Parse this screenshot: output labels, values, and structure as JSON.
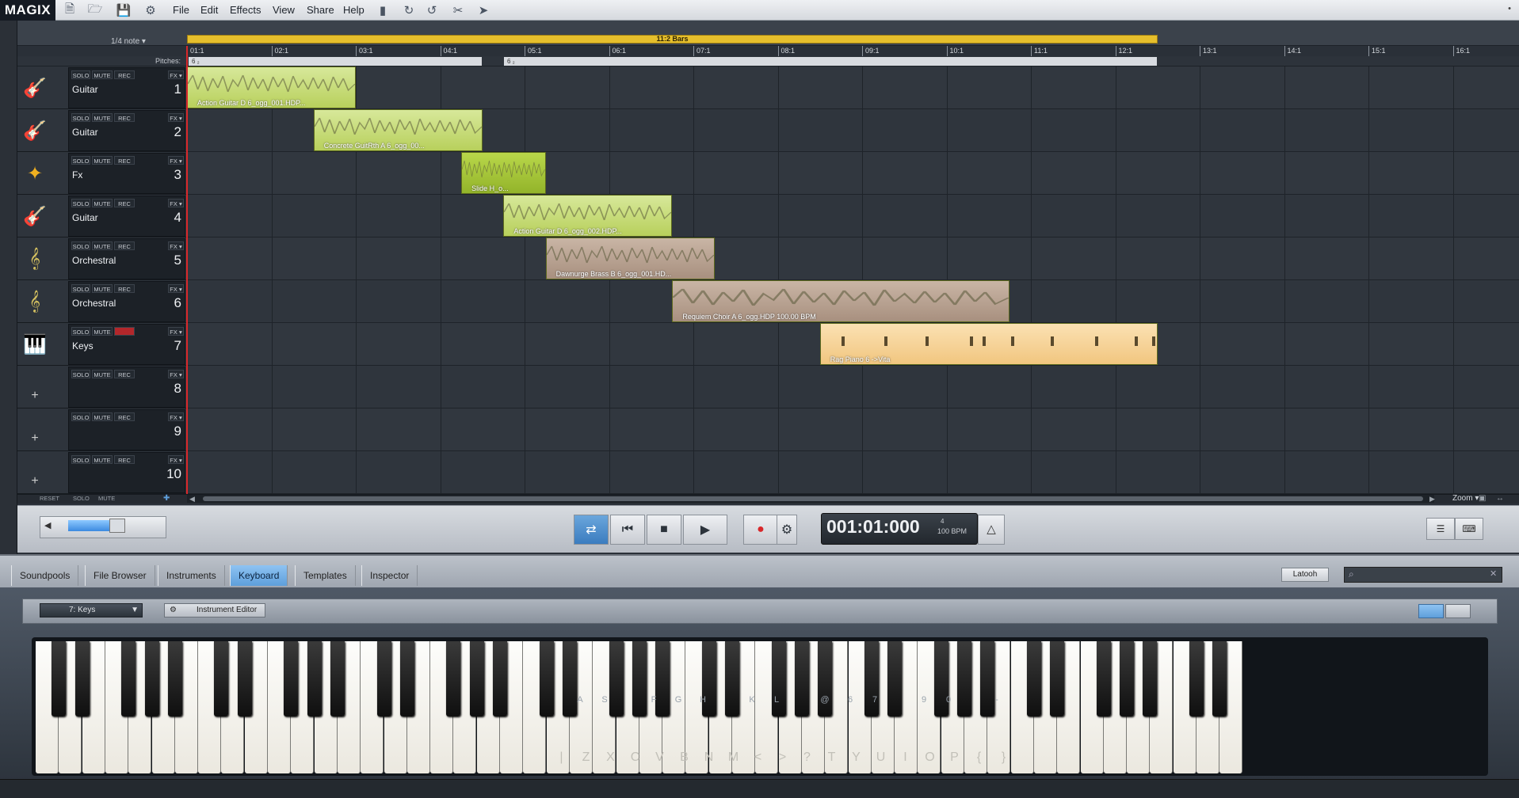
{
  "app": {
    "logo": "MAGIX"
  },
  "menu": [
    "File",
    "Edit",
    "Effects",
    "View",
    "Share",
    "Help"
  ],
  "arranger": {
    "quantize": "1/4 note",
    "range_label": "11:2 Bars",
    "pitches_label": "Pitches:",
    "pitch_segments": [
      "6 ₂",
      "6 ₂"
    ],
    "ruler": [
      "01:1",
      "02:1",
      "03:1",
      "04:1",
      "05:1",
      "06:1",
      "07:1",
      "08:1",
      "09:1",
      "10:1",
      "11:1",
      "12:1",
      "13:1",
      "14:1",
      "15:1",
      "16:1"
    ],
    "track_buttons": {
      "solo": "SOLO",
      "mute": "MUTE",
      "rec": "REC",
      "fx": "FX ▾"
    },
    "tracks": [
      {
        "name": "Guitar",
        "num": "1",
        "icon": "guitar-icon"
      },
      {
        "name": "Guitar",
        "num": "2",
        "icon": "guitar-icon"
      },
      {
        "name": "Fx",
        "num": "3",
        "icon": "soundfx-icon"
      },
      {
        "name": "Guitar",
        "num": "4",
        "icon": "guitar-icon"
      },
      {
        "name": "Orchestral",
        "num": "5",
        "icon": "orchestral-icon"
      },
      {
        "name": "Orchestral",
        "num": "6",
        "icon": "orchestral-icon"
      },
      {
        "name": "Keys",
        "num": "7",
        "icon": "keys-icon"
      },
      {
        "name": "",
        "num": "8",
        "icon": "add-icon"
      },
      {
        "name": "",
        "num": "9",
        "icon": "add-icon"
      },
      {
        "name": "",
        "num": "10",
        "icon": "add-icon"
      }
    ],
    "clips": [
      {
        "track": 1,
        "label": "Action Guitar D 6_ogg_001.HDP...",
        "color": "green"
      },
      {
        "track": 2,
        "label": "Concrete GuitRth A 6_ogg_00...",
        "color": "green"
      },
      {
        "track": 3,
        "label": "Slide H_o...",
        "color": "green2"
      },
      {
        "track": 4,
        "label": "Action Guitar D 6_ogg_002.HDP...",
        "color": "green"
      },
      {
        "track": 5,
        "label": "Dawnurge Brass B 6_ogg_001.HD...",
        "color": "brown"
      },
      {
        "track": 6,
        "label": "Requiem Choir A 6_ogg.HDP  100.00 BPM",
        "color": "brown"
      },
      {
        "track": 7,
        "label": "Rag Piano 6 ->Vita",
        "color": "piano"
      }
    ],
    "footer": {
      "reset": "RESET",
      "solo": "SOLO",
      "mute": "MUTE",
      "zoom": "Zoom ▾"
    }
  },
  "transport": {
    "time": "001:01:000",
    "bpm": "100 BPM",
    "bpm_top": "4"
  },
  "media_pool": {
    "tabs": [
      "Soundpools",
      "File Browser",
      "Instruments",
      "Keyboard",
      "Templates",
      "Inspector"
    ],
    "active_tab": "Keyboard",
    "latooh": "Latooh",
    "search_placeholder": ""
  },
  "keyboard": {
    "instrument": "7: Keys",
    "instrument_editor": "Instrument Editor",
    "black_key_labels": [
      "A",
      "S",
      "",
      "F",
      "G",
      "H",
      "",
      "K",
      "L",
      "",
      "@",
      "6",
      "7",
      "",
      "9",
      "0",
      "",
      "-"
    ],
    "white_key_labels": [
      "|",
      "Z",
      "X",
      "C",
      "V",
      "B",
      "N",
      "M",
      "<",
      ">",
      "?",
      "T",
      "Y",
      "U",
      "I",
      "O",
      "P",
      "{",
      "}"
    ]
  },
  "colors": {
    "accent": "#5e9fdb",
    "range_bar": "#e6bf2c",
    "playhead": "#d8272a",
    "record": "#d8272a"
  }
}
